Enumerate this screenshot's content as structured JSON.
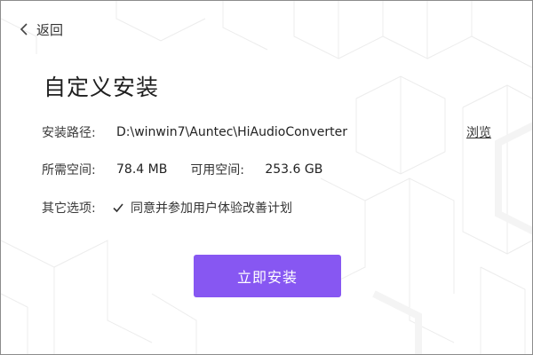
{
  "nav": {
    "back_label": "返回",
    "back_icon": "chevron-left-icon"
  },
  "title": "自定义安装",
  "install_path": {
    "label": "安装路径:",
    "value": "D:\\winwin7\\Auntec\\HiAudioConverter",
    "browse_label": "浏览"
  },
  "space": {
    "required_label": "所需空间:",
    "required_value": "78.4 MB",
    "available_label": "可用空间:",
    "available_value": "253.6 GB"
  },
  "options": {
    "label": "其它选项:",
    "checkbox_label": "同意并参加用户体验改善计划",
    "checkbox_checked": true,
    "checkbox_icon": "checkmark-icon"
  },
  "install_button": {
    "label": "立即安装"
  },
  "colors": {
    "accent": "#8757f2",
    "background": "#ffffff",
    "pattern": "#f0f0f0"
  }
}
